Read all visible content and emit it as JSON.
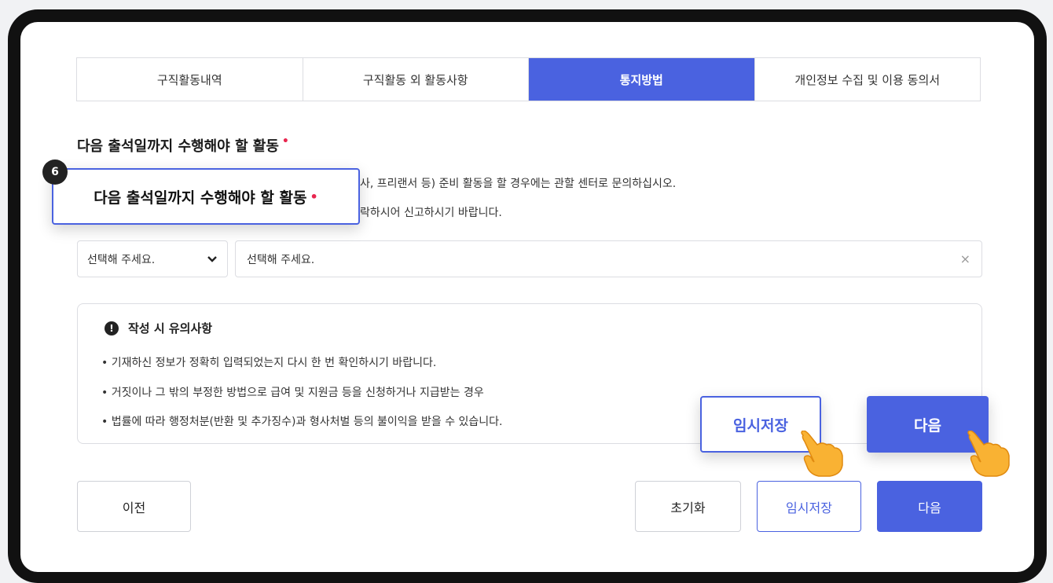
{
  "tabs": [
    {
      "label": "구직활동내역",
      "active": false
    },
    {
      "label": "구직활동 외 활동사항",
      "active": false
    },
    {
      "label": "통지방법",
      "active": true
    },
    {
      "label": "개인정보 수집 및 이용 동의서",
      "active": false
    }
  ],
  "section": {
    "title": "다음 출석일까지 수행해야 할 활동",
    "required_mark": "•",
    "desc_line1": "사, 프리랜서 등) 준비 활동을 할 경우에는 관할 센터로 문의하십시오.",
    "desc_line2": "락하시어 신고하시기 바랍니다."
  },
  "selects": {
    "category_value": "선택해 주세요.",
    "detail_value": "선택해 주세요.",
    "clear_symbol": "×"
  },
  "notice": {
    "icon_text": "!",
    "title": "작성 시 유의사항",
    "items": [
      "• 기재하신 정보가 정확히 입력되었는지 다시 한 번 확인하시기 바랍니다.",
      "• 거짓이나 그 밖의 부정한 방법으로 급여 및 지원금 등을 신청하거나 지급받는 경우",
      "• 법률에 따라 행정처분(반환 및 추가징수)과 형사처벌 등의 불이익을 받을 수 있습니다."
    ]
  },
  "buttons": {
    "prev": "이전",
    "reset": "초기화",
    "save": "임시저장",
    "next": "다음"
  },
  "callouts": {
    "step_number": "6",
    "title": "다음 출석일까지 수행해야 할 활동",
    "save": "임시저장",
    "next": "다음"
  },
  "colors": {
    "accent": "#4a62e0",
    "required": "#e8264f"
  },
  "icons": [
    "chevron-down-icon",
    "clear-icon",
    "alert-icon",
    "pointing-hand-icon"
  ]
}
